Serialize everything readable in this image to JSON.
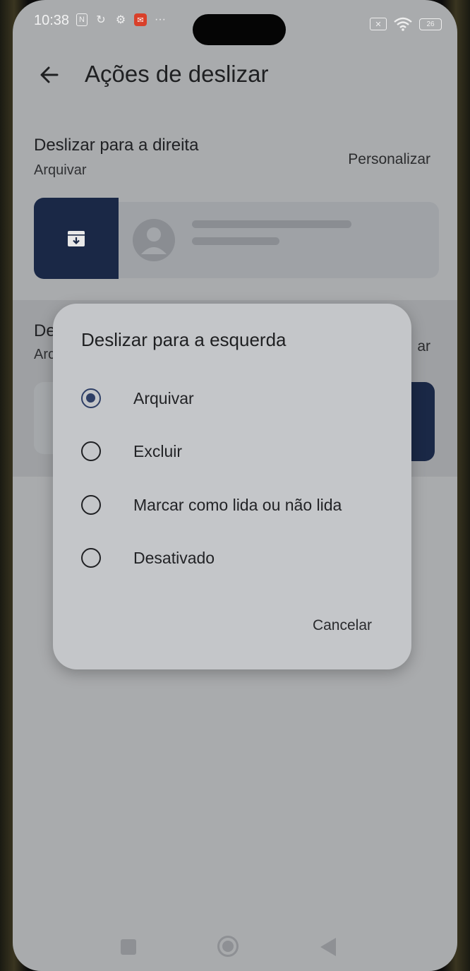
{
  "status_bar": {
    "time": "10:38",
    "battery": "26",
    "left_icons": [
      "nfc-icon",
      "sync-icon",
      "gear-icon",
      "notification-icon",
      "more-icon"
    ],
    "right_icons": [
      "sim-off-icon",
      "wifi-icon",
      "battery-icon"
    ]
  },
  "header": {
    "title": "Ações de deslizar",
    "back_icon": "arrow-left-icon"
  },
  "swipe_right": {
    "title": "Deslizar para a direita",
    "value": "Arquivar",
    "customize_label": "Personalizar",
    "action_icon": "archive-icon",
    "action_color": "#1a2846"
  },
  "swipe_left": {
    "title_partial": "De",
    "value_partial": "Arc",
    "customize_partial": "ar"
  },
  "dialog": {
    "title": "Deslizar para a esquerda",
    "options": [
      {
        "label": "Arquivar",
        "selected": true
      },
      {
        "label": "Excluir",
        "selected": false
      },
      {
        "label": "Marcar como lida ou não lida",
        "selected": false
      },
      {
        "label": "Desativado",
        "selected": false
      }
    ],
    "cancel_label": "Cancelar",
    "accent": "#2f3f66"
  },
  "nav": {
    "icons": [
      "recent-apps-icon",
      "home-icon",
      "back-icon"
    ]
  }
}
